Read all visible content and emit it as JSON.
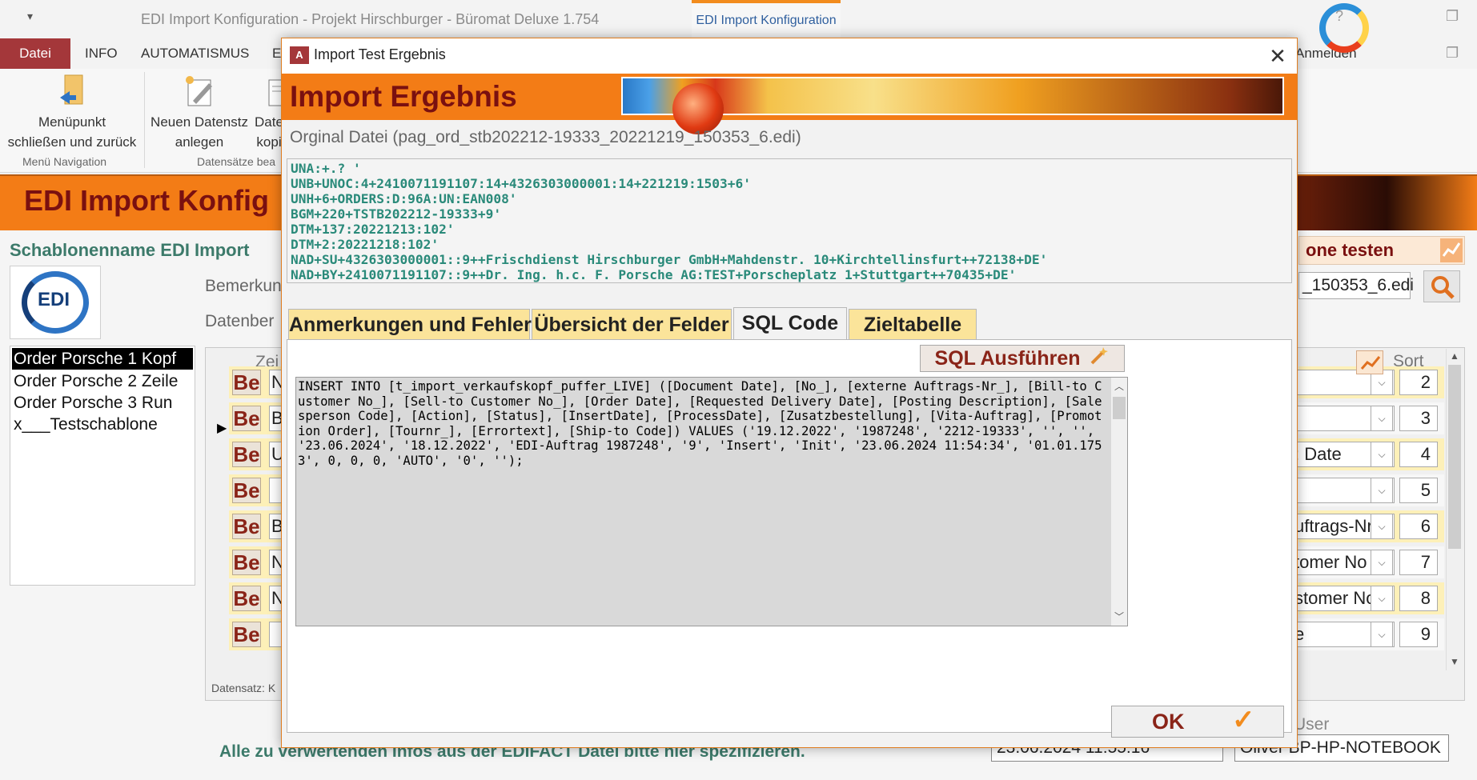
{
  "window": {
    "qat_icon": "dropdown-arrow-icon",
    "title": "EDI Import Konfiguration - Projekt Hirschburger -  Büromat Deluxe 1.754",
    "context_tab": "EDI Import Konfiguration",
    "help": "?",
    "restore": "❐"
  },
  "menu": {
    "file": "Datei",
    "items": [
      "INFO",
      "AUTOMATISMUS",
      "E"
    ],
    "login": "Anmelden"
  },
  "ribbon": {
    "buttons": [
      {
        "line1": "Menüpunkt",
        "line2": "schließen und zurück",
        "icon": "back-arrow-icon"
      },
      {
        "line1": "Neuen Datenstz",
        "line2": "anlegen",
        "icon": "new-record-icon"
      },
      {
        "line1": "Date",
        "line2": "kopi",
        "icon": "copy-record-icon"
      }
    ],
    "groups": [
      "Menü Navigation",
      "Datensätze bea"
    ]
  },
  "form": {
    "title": "EDI Import Konfig",
    "template_label": "Schablonenname EDI Import",
    "edi_logo_text": "EDI",
    "templates": [
      "Order Porsche 1 Kopf",
      "Order Porsche 2 Zeile",
      "Order Porsche 3 Run",
      "x___Testschablone"
    ],
    "bemerkung_label": "Bemerkun",
    "datenbereich_label": "Datenber",
    "grid_header": "Zei",
    "be_label": "Be",
    "row_initials": [
      "N",
      "B",
      "U",
      "",
      "B",
      "N",
      "N",
      ""
    ],
    "right_combos": [
      "",
      "",
      ": Date",
      "",
      "uftrags-Nr",
      "tomer No",
      "stomer No",
      "e"
    ],
    "sort_header": "Sort",
    "sort_values": [
      "2",
      "3",
      "4",
      "5",
      "6",
      "7",
      "8",
      "9"
    ],
    "test_button": "one testen",
    "filename_field": "_150353_6.edi",
    "datensatz_label": "Datensatz:  K",
    "bottom_info": "Alle zu verwertenden Infos aus der EDIFACT Datei bitte hier spezifizieren.",
    "user_label": "User",
    "date_value": "23.06.2024 11:55:16",
    "user_value": "Oliver BP-HP-NOTEBOOK"
  },
  "dialog": {
    "app_icon_text": "A",
    "title": "Import Test Ergebnis",
    "close": "✕",
    "header": "Import Ergebnis",
    "orig_file_label": "Orginal Datei (pag_ord_stb202212-19333_20221219_150353_6.edi)",
    "edi_lines": [
      "UNA:+.? '",
      "UNB+UNOC:4+2410071191107:14+4326303000001:14+221219:1503+6'",
      "UNH+6+ORDERS:D:96A:UN:EAN008'",
      "BGM+220+TSTB202212-19333+9'",
      "DTM+137:20221213:102'",
      "DTM+2:20221218:102'",
      "NAD+SU+4326303000001::9++Frischdienst Hirschburger GmbH+Mahdenstr. 10+Kirchtellinsfurt++72138+DE'",
      "NAD+BY+2410071191107::9++Dr. Ing. h.c. F. Porsche AG:TEST+Porscheplatz 1+Stuttgart++70435+DE'"
    ],
    "tabs": [
      "Anmerkungen und Fehler",
      "Übersicht der Felder",
      "SQL Code",
      "Zieltabelle"
    ],
    "active_tab": 2,
    "sql_button": "SQL Ausführen",
    "sql_code": "INSERT INTO [t_import_verkaufskopf_puffer_LIVE] ([Document Date], [No_], [externe Auftrags-Nr_], [Bill-to Customer No_], [Sell-to Customer No_], [Order Date], [Requested Delivery Date], [Posting Description], [Salesperson Code], [Action], [Status], [InsertDate], [ProcessDate], [Zusatzbestellung], [Vita-Auftrag], [Promotion Order], [Tournr_], [Errortext], [Ship-to Code]) VALUES ('19.12.2022', '1987248', '2212-19333', '', '', '23.06.2024', '18.12.2022', 'EDI-Auftrag 1987248', '9', 'Insert', 'Init', '23.06.2024 11:54:34', '01.01.1753', 0, 0, 0, 'AUTO', '0', '');",
    "ok_button": "OK"
  }
}
